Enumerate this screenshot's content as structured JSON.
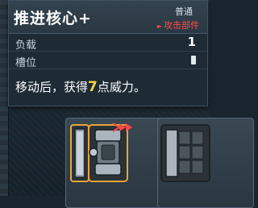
{
  "card": {
    "title": "推进核心",
    "title_suffix": "+",
    "rarity": "普通",
    "tag": "攻击部件",
    "tag_icon": "red-triangle-arrow",
    "stats": [
      {
        "label": "负载",
        "value": "1"
      },
      {
        "label": "槽位",
        "value": ""
      }
    ],
    "description": {
      "prefix": "移动后，获得",
      "number": "7",
      "suffix": "点威力。"
    }
  },
  "colors": {
    "tag_red": "#ff4a48",
    "highlight_number": "#ffd43a",
    "selected_outline": "#e8a63a"
  },
  "parts": [
    {
      "name": "thruster-core-part",
      "selected": true
    },
    {
      "name": "grid-block-part",
      "selected": false
    }
  ]
}
